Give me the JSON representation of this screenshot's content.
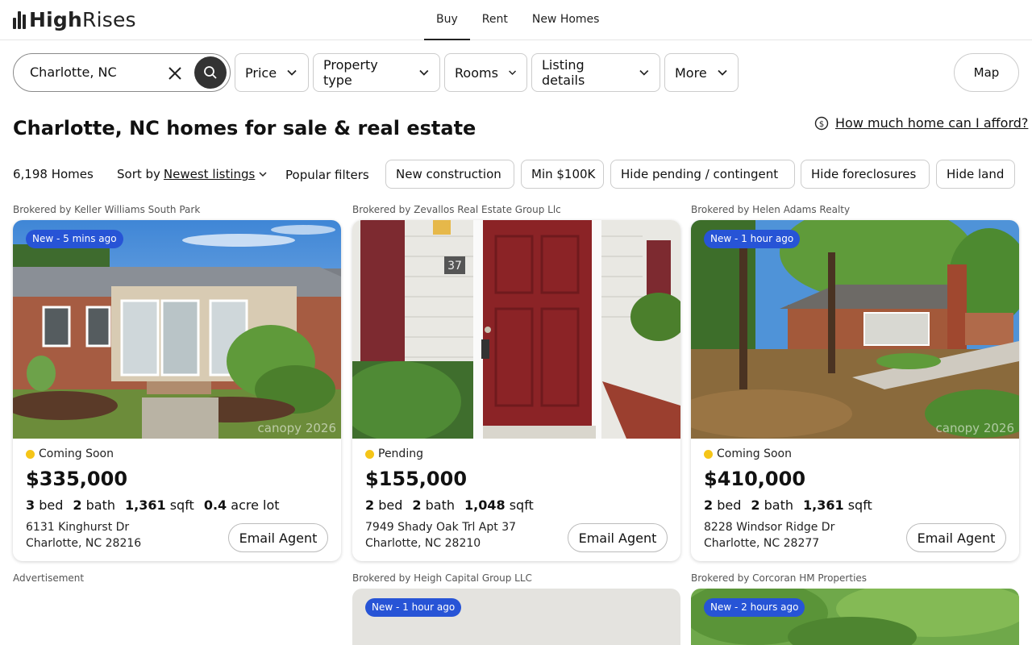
{
  "header": {
    "logo_bold": "High",
    "logo_light": "Rises",
    "nav": [
      "Buy",
      "Rent",
      "New Homes"
    ],
    "active_nav": "Buy"
  },
  "search": {
    "value": "Charlotte, NC"
  },
  "filters": [
    "Price",
    "Property type",
    "Rooms",
    "Listing details",
    "More"
  ],
  "map_label": "Map",
  "page_title": "Charlotte, NC homes for sale & real estate",
  "afford_link": "How much home can I afford?",
  "results": {
    "count": "6,198 Homes",
    "sort_prefix": "Sort by",
    "sort_value": "Newest listings",
    "popular_label": "Popular filters",
    "chips": [
      "New construction",
      "Min $100K",
      "Hide pending / contingent",
      "Hide foreclosures",
      "Hide land"
    ]
  },
  "listings": [
    {
      "broker": "Brokered by Keller Williams South Park",
      "badge": "New - 5 mins ago",
      "watermark": "canopy 2026",
      "status": "Coming Soon",
      "price": "$335,000",
      "beds": "3",
      "beds_label": "bed",
      "baths": "2",
      "baths_label": "bath",
      "sqft": "1,361",
      "sqft_label": "sqft",
      "lot": "0.4",
      "lot_label": "acre lot",
      "address_line1": "6131 Kinghurst Dr",
      "address_line2": "Charlotte, NC 28216",
      "email_label": "Email Agent"
    },
    {
      "broker": "Brokered by Zevallos Real Estate Group Llc",
      "unit_number": "37",
      "status": "Pending",
      "price": "$155,000",
      "beds": "2",
      "beds_label": "bed",
      "baths": "2",
      "baths_label": "bath",
      "sqft": "1,048",
      "sqft_label": "sqft",
      "address_line1": "7949 Shady Oak Trl Apt 37",
      "address_line2": "Charlotte, NC 28210",
      "email_label": "Email Agent"
    },
    {
      "broker": "Brokered by Helen Adams Realty",
      "badge": "New - 1 hour ago",
      "watermark": "canopy 2026",
      "status": "Coming Soon",
      "price": "$410,000",
      "beds": "2",
      "beds_label": "bed",
      "baths": "2",
      "baths_label": "bath",
      "sqft": "1,361",
      "sqft_label": "sqft",
      "address_line1": "8228 Windsor Ridge Dr",
      "address_line2": "Charlotte, NC 28277",
      "email_label": "Email Agent"
    }
  ],
  "advertisement_label": "Advertisement",
  "second_row": [
    {
      "broker": "Brokered by Heigh Capital Group LLC",
      "badge": "New - 1 hour ago"
    },
    {
      "broker": "Brokered by Corcoran HM Properties",
      "badge": "New - 2 hours ago"
    }
  ],
  "colors": {
    "badge": "#2754d6",
    "status_dot": "#f5c518",
    "search_button": "#333333"
  }
}
